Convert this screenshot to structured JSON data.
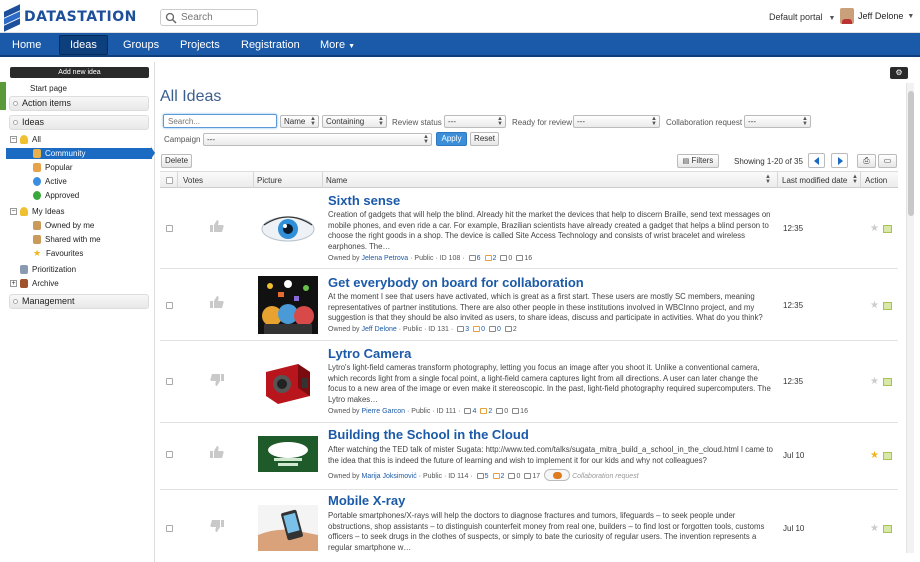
{
  "header": {
    "logo": "DATASTATION",
    "search_placeholder": "Search",
    "portal": "Default portal",
    "user_name": "Jeff Delone"
  },
  "nav": [
    "Home",
    "Ideas",
    "Groups",
    "Projects",
    "Registration",
    "More"
  ],
  "sidebar": {
    "add_button": "Add new idea",
    "start_page": "Start page",
    "action_items": "Action items",
    "ideas": "Ideas",
    "all": "All",
    "community": "Community",
    "popular": "Popular",
    "active": "Active",
    "approved": "Approved",
    "my_ideas": "My Ideas",
    "owned": "Owned by me",
    "shared": "Shared with me",
    "favourites": "Favourites",
    "prioritization": "Prioritization",
    "archive": "Archive",
    "management": "Management"
  },
  "main": {
    "title": "All Ideas",
    "search_placeholder": "Search...",
    "name_select": "Name",
    "containing_select": "Containing",
    "review_status_label": "Review status",
    "review_status_value": "---",
    "ready_label": "Ready for review",
    "ready_value": "---",
    "collab_label": "Collaboration request",
    "collab_value": "---",
    "campaign_label": "Campaign",
    "campaign_value": "---",
    "apply": "Apply",
    "reset": "Reset",
    "delete": "Delete",
    "filters": "Filters",
    "showing": "Showing 1-20 of 35"
  },
  "table": {
    "columns": {
      "votes": "Votes",
      "picture": "Picture",
      "name": "Name",
      "modified": "Last modified date",
      "action": "Action"
    },
    "rows": [
      {
        "title": "Sixth sense",
        "desc": "Creation of gadgets that will help the blind. Already hit the market the devices that help to discern Braille, send text messages on mobile phones, and even ride a car. For example, Brazilian scientists have already created a gadget that helps a blind person to choose the right goods in a shop. The device is called Site Access Technology and consists of wrist bracelet and wireless earphones. The…",
        "owned_by": "Owned by",
        "owner": "Jelena Petrova",
        "info": "· Public · ID 108 ·",
        "c1": "6",
        "c2": "2",
        "c3": "0",
        "c4": "16",
        "time": "12:35",
        "vote": "up",
        "starred": false
      },
      {
        "title": "Get everybody on board for collaboration",
        "desc": "At the moment I see that users have activated, which is great as a first start. These users are mostly SC members, meaning representatives of partner institutions.  There are also other people in these institutions involved in WBCInno project, and my suggestion is that they should be also invited as users, to share ideas, discuss and participate in activities.   What do you think?",
        "owned_by": "Owned by",
        "owner": "Jeff Delone",
        "info": "· Public · ID 131 ·",
        "c1": "3",
        "c2": "0",
        "c3": "0",
        "c4": "2",
        "time": "12:35",
        "vote": "up",
        "starred": false
      },
      {
        "title": "Lytro Camera",
        "desc": "Lytro's light-field cameras transform photography, letting you focus an image after you shoot it. Unlike a conventional camera, which records light from a single focal point, a light-field camera captures light from all directions. A user can later change the focus to a new area of the image or even make it stereoscopic. In the past, light-field photography required supercomputers. The Lytro makes…",
        "owned_by": "Owned by",
        "owner": "Pierre Garcon",
        "info": "· Public · ID 111 ·",
        "c1": "4",
        "c2": "2",
        "c3": "0",
        "c4": "16",
        "time": "12:35",
        "vote": "down",
        "starred": false
      },
      {
        "title": "Building the School in the Cloud",
        "desc": "After watching the TED talk of mister Sugata: http://www.ted.com/talks/sugata_mitra_build_a_school_in_the_cloud.html I came to the idea that this is indeed the future of learning and wish to implement it for our kids and why not colleagues?",
        "owned_by": "Owned by",
        "owner": "Marija Joksimović",
        "info": "· Public · ID 114 ·",
        "c1": "5",
        "c2": "2",
        "c3": "0",
        "c4": "17",
        "collab": "Collaboration request",
        "time": "Jul 10",
        "vote": "up",
        "starred": true
      },
      {
        "title": "Mobile X-ray",
        "desc": "Portable smartphones/X-rays will help the doctors to diagnose fractures and tumors, lifeguards – to seek people under obstructions, shop assistants – to distinguish counterfeit money from real one, builders – to find lost or forgotten tools, customs officers – to seek drugs in the clothes of suspects, or simply to bate the curiosity of regular users. The invention represents a regular smartphone w…",
        "time": "Jul 10",
        "vote": "down",
        "starred": false
      }
    ]
  },
  "colors": {
    "brand": "#1b5aa8",
    "nav_bg": "#1b5aa8",
    "selected": "#1b6bc3",
    "star": "#f3b51a"
  }
}
